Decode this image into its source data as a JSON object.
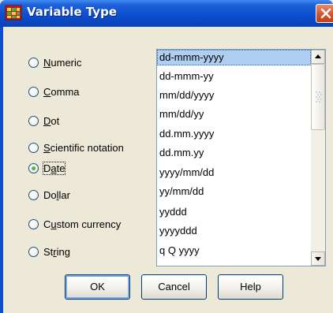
{
  "dialog": {
    "title": "Variable Type",
    "close_icon": "close-icon",
    "app_icon": "spss-data-icon"
  },
  "variable_types": {
    "selected": "Date",
    "options": [
      {
        "label": "Numeric",
        "mnemonic": "N"
      },
      {
        "label": "Comma",
        "mnemonic": "C"
      },
      {
        "label": "Dot",
        "mnemonic": "D"
      },
      {
        "label": "Scientific notation",
        "mnemonic": "S"
      },
      {
        "label": "Date",
        "mnemonic": "a"
      },
      {
        "label": "Dollar",
        "mnemonic": "l"
      },
      {
        "label": "Custom currency",
        "mnemonic": "u"
      },
      {
        "label": "String",
        "mnemonic": "r"
      }
    ]
  },
  "date_formats": {
    "selected": "dd-mmm-yyyy",
    "items": [
      "dd-mmm-yyyy",
      "dd-mmm-yy",
      "mm/dd/yyyy",
      "mm/dd/yy",
      "dd.mm.yyyy",
      "dd.mm.yy",
      "yyyy/mm/dd",
      "yy/mm/dd",
      "yyddd",
      "yyyyddd",
      "q Q yyyy"
    ]
  },
  "buttons": {
    "ok": "OK",
    "cancel": "Cancel",
    "help": "Help"
  },
  "colors": {
    "titlebar": "#0b4fcf",
    "selection": "#aecff2",
    "close": "#d2502a",
    "dialog_bg": "#ece9d8"
  }
}
